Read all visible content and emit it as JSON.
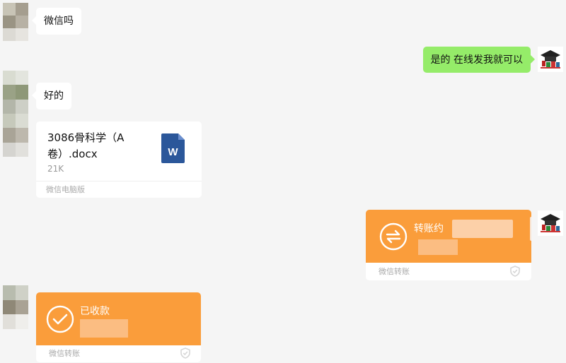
{
  "messages": {
    "m1": {
      "text": "微信吗"
    },
    "m2": {
      "text": "是的 在线发我就可以"
    },
    "m3": {
      "text": "好的"
    },
    "file": {
      "name": "3086骨科学（A卷）.docx",
      "size": "21K",
      "source": "微信电脑版"
    },
    "transfer_out": {
      "status": "转账约",
      "footer": "微信转账"
    },
    "transfer_in": {
      "status": "已收款",
      "footer": "微信转账"
    }
  },
  "colors": {
    "bg": "#f5f5f5",
    "bubble_self": "#95ec69",
    "bubble_other": "#ffffff",
    "transfer_orange": "#fa9d3b",
    "word_blue": "#2b579a"
  },
  "icons": {
    "file_type": "word-doc-icon",
    "transfer_pending": "exchange-arrows-icon",
    "transfer_received": "check-circle-icon",
    "transfer_footer": "shield-icon"
  }
}
